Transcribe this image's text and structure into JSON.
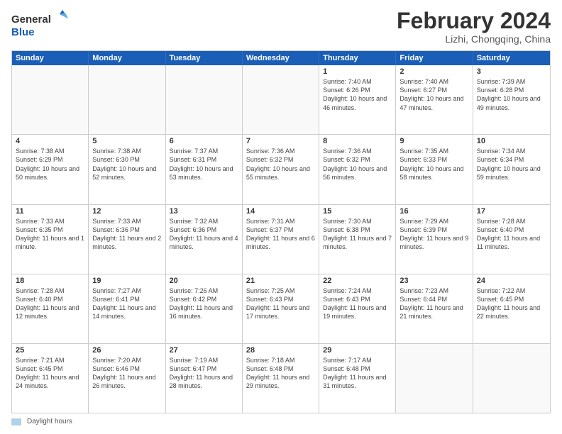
{
  "header": {
    "logo_general": "General",
    "logo_blue": "Blue",
    "month_title": "February 2024",
    "location": "Lizhi, Chongqing, China"
  },
  "days_of_week": [
    "Sunday",
    "Monday",
    "Tuesday",
    "Wednesday",
    "Thursday",
    "Friday",
    "Saturday"
  ],
  "weeks": [
    [
      {
        "day": "",
        "text": ""
      },
      {
        "day": "",
        "text": ""
      },
      {
        "day": "",
        "text": ""
      },
      {
        "day": "",
        "text": ""
      },
      {
        "day": "1",
        "text": "Sunrise: 7:40 AM\nSunset: 6:26 PM\nDaylight: 10 hours and 46 minutes."
      },
      {
        "day": "2",
        "text": "Sunrise: 7:40 AM\nSunset: 6:27 PM\nDaylight: 10 hours and 47 minutes."
      },
      {
        "day": "3",
        "text": "Sunrise: 7:39 AM\nSunset: 6:28 PM\nDaylight: 10 hours and 49 minutes."
      }
    ],
    [
      {
        "day": "4",
        "text": "Sunrise: 7:38 AM\nSunset: 6:29 PM\nDaylight: 10 hours and 50 minutes."
      },
      {
        "day": "5",
        "text": "Sunrise: 7:38 AM\nSunset: 6:30 PM\nDaylight: 10 hours and 52 minutes."
      },
      {
        "day": "6",
        "text": "Sunrise: 7:37 AM\nSunset: 6:31 PM\nDaylight: 10 hours and 53 minutes."
      },
      {
        "day": "7",
        "text": "Sunrise: 7:36 AM\nSunset: 6:32 PM\nDaylight: 10 hours and 55 minutes."
      },
      {
        "day": "8",
        "text": "Sunrise: 7:36 AM\nSunset: 6:32 PM\nDaylight: 10 hours and 56 minutes."
      },
      {
        "day": "9",
        "text": "Sunrise: 7:35 AM\nSunset: 6:33 PM\nDaylight: 10 hours and 58 minutes."
      },
      {
        "day": "10",
        "text": "Sunrise: 7:34 AM\nSunset: 6:34 PM\nDaylight: 10 hours and 59 minutes."
      }
    ],
    [
      {
        "day": "11",
        "text": "Sunrise: 7:33 AM\nSunset: 6:35 PM\nDaylight: 11 hours and 1 minute."
      },
      {
        "day": "12",
        "text": "Sunrise: 7:33 AM\nSunset: 6:36 PM\nDaylight: 11 hours and 2 minutes."
      },
      {
        "day": "13",
        "text": "Sunrise: 7:32 AM\nSunset: 6:36 PM\nDaylight: 11 hours and 4 minutes."
      },
      {
        "day": "14",
        "text": "Sunrise: 7:31 AM\nSunset: 6:37 PM\nDaylight: 11 hours and 6 minutes."
      },
      {
        "day": "15",
        "text": "Sunrise: 7:30 AM\nSunset: 6:38 PM\nDaylight: 11 hours and 7 minutes."
      },
      {
        "day": "16",
        "text": "Sunrise: 7:29 AM\nSunset: 6:39 PM\nDaylight: 11 hours and 9 minutes."
      },
      {
        "day": "17",
        "text": "Sunrise: 7:28 AM\nSunset: 6:40 PM\nDaylight: 11 hours and 11 minutes."
      }
    ],
    [
      {
        "day": "18",
        "text": "Sunrise: 7:28 AM\nSunset: 6:40 PM\nDaylight: 11 hours and 12 minutes."
      },
      {
        "day": "19",
        "text": "Sunrise: 7:27 AM\nSunset: 6:41 PM\nDaylight: 11 hours and 14 minutes."
      },
      {
        "day": "20",
        "text": "Sunrise: 7:26 AM\nSunset: 6:42 PM\nDaylight: 11 hours and 16 minutes."
      },
      {
        "day": "21",
        "text": "Sunrise: 7:25 AM\nSunset: 6:43 PM\nDaylight: 11 hours and 17 minutes."
      },
      {
        "day": "22",
        "text": "Sunrise: 7:24 AM\nSunset: 6:43 PM\nDaylight: 11 hours and 19 minutes."
      },
      {
        "day": "23",
        "text": "Sunrise: 7:23 AM\nSunset: 6:44 PM\nDaylight: 11 hours and 21 minutes."
      },
      {
        "day": "24",
        "text": "Sunrise: 7:22 AM\nSunset: 6:45 PM\nDaylight: 11 hours and 22 minutes."
      }
    ],
    [
      {
        "day": "25",
        "text": "Sunrise: 7:21 AM\nSunset: 6:45 PM\nDaylight: 11 hours and 24 minutes."
      },
      {
        "day": "26",
        "text": "Sunrise: 7:20 AM\nSunset: 6:46 PM\nDaylight: 11 hours and 26 minutes."
      },
      {
        "day": "27",
        "text": "Sunrise: 7:19 AM\nSunset: 6:47 PM\nDaylight: 11 hours and 28 minutes."
      },
      {
        "day": "28",
        "text": "Sunrise: 7:18 AM\nSunset: 6:48 PM\nDaylight: 11 hours and 29 minutes."
      },
      {
        "day": "29",
        "text": "Sunrise: 7:17 AM\nSunset: 6:48 PM\nDaylight: 11 hours and 31 minutes."
      },
      {
        "day": "",
        "text": ""
      },
      {
        "day": "",
        "text": ""
      }
    ]
  ],
  "footer": {
    "legend_label": "Daylight hours"
  }
}
